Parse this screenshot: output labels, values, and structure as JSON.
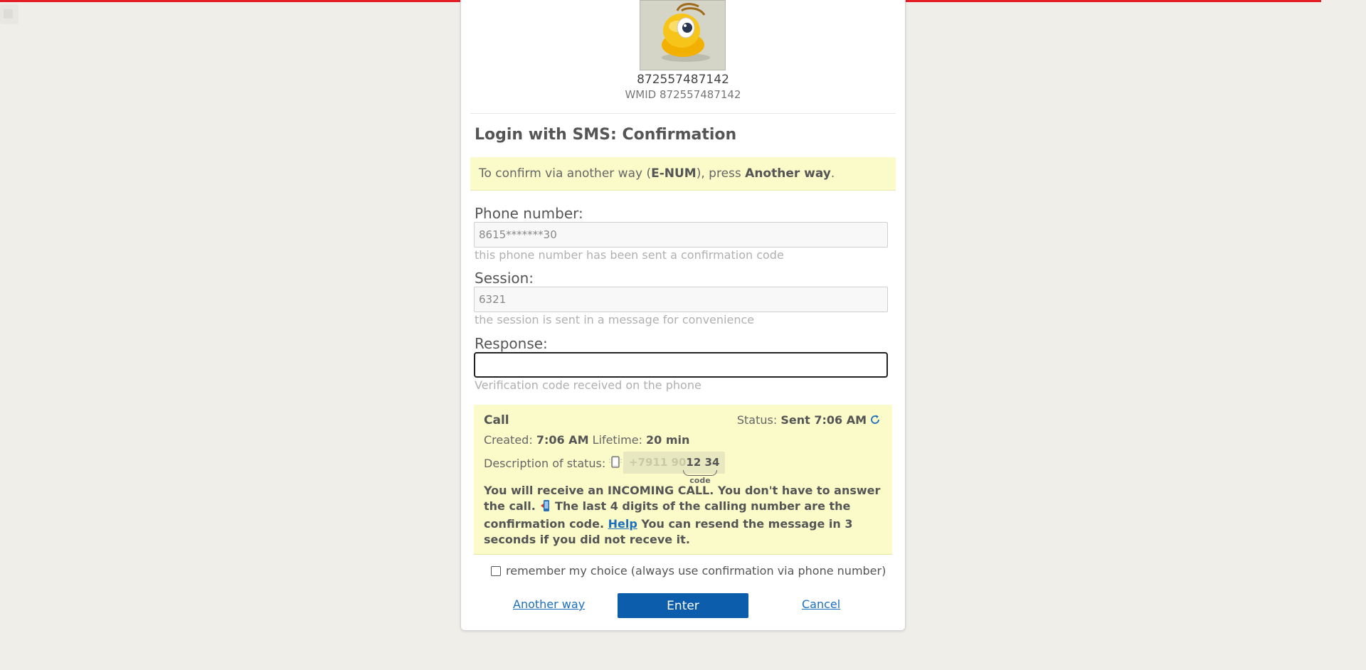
{
  "profile": {
    "number": "872557487142",
    "wmid_line": "WMID 872557487142"
  },
  "title": "Login with SMS: Confirmation",
  "notice": {
    "prefix": "To confirm via another way (",
    "method": "E-NUM",
    "middle": "), press ",
    "action": "Another way",
    "suffix": "."
  },
  "fields": {
    "phone": {
      "label": "Phone number:",
      "value": "8615*******30",
      "hint": "this phone number has been sent a confirmation code"
    },
    "session": {
      "label": "Session:",
      "value": "6321",
      "hint": "the session is sent in a message for convenience"
    },
    "response": {
      "label": "Response:",
      "value": "",
      "hint": "Verification code received on the phone"
    }
  },
  "call": {
    "title": "Call",
    "status_label": "Status:",
    "status_value": "Sent 7:06 AM",
    "created_label": "Created:",
    "created_value": "7:06 AM",
    "lifetime_label": "Lifetime:",
    "lifetime_value": "20 min",
    "desc_label": "Description of status:",
    "sample_prefix": "+7911 90",
    "sample_code": "12 34",
    "code_label": "code",
    "msg_part1": "You will receive an INCOMING CALL. You don't have to answer the call.",
    "msg_part2": "The last 4 digits of the calling number are the confirmation code.",
    "help_link": "Help",
    "msg_part3": "You can resend the message in 3 seconds if you did not receve it."
  },
  "remember_label": "remember my choice (always use confirmation via phone number)",
  "buttons": {
    "another_way": "Another way",
    "enter": "Enter",
    "cancel": "Cancel"
  },
  "colors": {
    "accent": "#0c5eac",
    "link": "#1d6fbf",
    "notice_bg": "#fafbc9",
    "progress": "#e31e24"
  }
}
